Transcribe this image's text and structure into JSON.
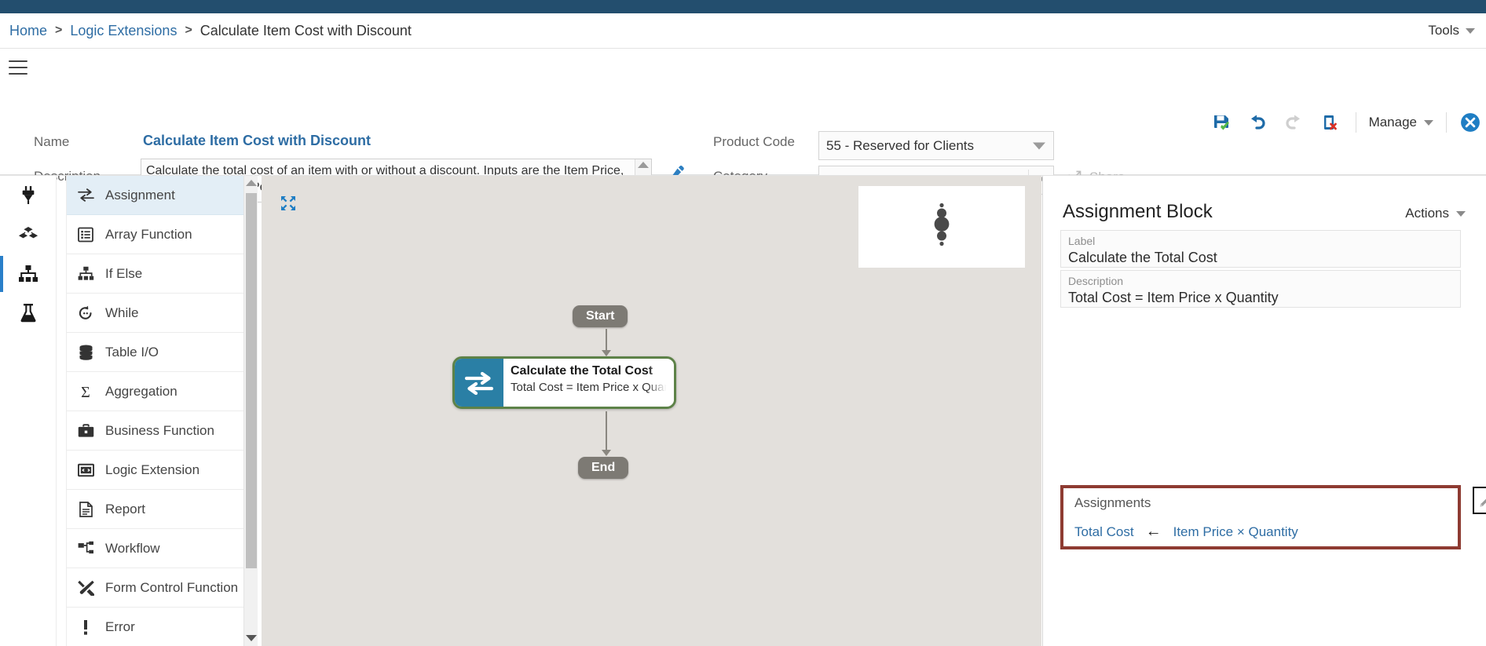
{
  "breadcrumb": {
    "home": "Home",
    "separator": ">",
    "section": "Logic Extensions",
    "current": "Calculate Item Cost with Discount"
  },
  "topnav": {
    "tools_label": "Tools"
  },
  "header": {
    "name_label": "Name",
    "name_value": "Calculate Item Cost with Discount",
    "description_label": "Description",
    "description_value": "Calculate the total cost of an item with or without a discount. Inputs are the Item Price, Quantity, Discount Percentage, and Apply Discount (True/False). The output is the Total Cost.",
    "product_code_label": "Product Code",
    "product_code_value": "55 - Reserved for Clients",
    "category_label": "Category",
    "category_value": "",
    "share_label": "Share",
    "manage_label": "Manage"
  },
  "toolbar": {
    "save_icon": "save-icon",
    "undo_icon": "undo-icon",
    "redo_icon": "redo-icon",
    "delete_icon": "delete-icon",
    "close_icon": "close-icon"
  },
  "rail": {
    "items": [
      {
        "name": "connections",
        "icon": "plug-icon",
        "active": false
      },
      {
        "name": "blocks",
        "icon": "cubes-icon",
        "active": false
      },
      {
        "name": "logic-map",
        "icon": "sitemap-icon",
        "active": true
      },
      {
        "name": "test",
        "icon": "flask-icon",
        "active": false
      }
    ]
  },
  "palette": {
    "items": [
      {
        "label": "Assignment",
        "icon": "assignment-icon",
        "selected": true
      },
      {
        "label": "Array Function",
        "icon": "array-function-icon",
        "selected": false
      },
      {
        "label": "If Else",
        "icon": "if-else-icon",
        "selected": false
      },
      {
        "label": "While",
        "icon": "while-icon",
        "selected": false
      },
      {
        "label": "Table I/O",
        "icon": "table-io-icon",
        "selected": false
      },
      {
        "label": "Aggregation",
        "icon": "aggregation-icon",
        "selected": false
      },
      {
        "label": "Business Function",
        "icon": "business-function-icon",
        "selected": false
      },
      {
        "label": "Logic Extension",
        "icon": "logic-extension-icon",
        "selected": false
      },
      {
        "label": "Report",
        "icon": "report-icon",
        "selected": false
      },
      {
        "label": "Workflow",
        "icon": "workflow-icon",
        "selected": false
      },
      {
        "label": "Form Control Function",
        "icon": "form-control-function-icon",
        "selected": false
      },
      {
        "label": "Error",
        "icon": "error-icon",
        "selected": false
      }
    ]
  },
  "canvas": {
    "expand_icon": "expand-icon",
    "start_node": "Start",
    "end_node": "End",
    "block_title": "Calculate the Total Cost",
    "block_subtitle": "Total Cost = Item Price x Quantity",
    "block_icon": "assignment-icon",
    "block_border_color": "#5d8248",
    "block_icon_color": "#2a7fa5"
  },
  "details": {
    "title": "Assignment Block",
    "actions_label": "Actions",
    "label_field_label": "Label",
    "label_field_value": "Calculate the Total Cost",
    "description_field_label": "Description",
    "description_field_value": "Total Cost = Item Price x Quantity",
    "assignments_label": "Assignments",
    "assignments": [
      {
        "target": "Total Cost",
        "arrow": "←",
        "expression": "Item Price × Quantity"
      }
    ],
    "edit_icon": "pencil-icon",
    "highlight_color": "#8e3b32"
  },
  "colors": {
    "top_bar": "#234e6e",
    "link": "#2e6da4",
    "canvas_bg": "#e3e0dc",
    "selection_bg": "#e3eef6"
  }
}
